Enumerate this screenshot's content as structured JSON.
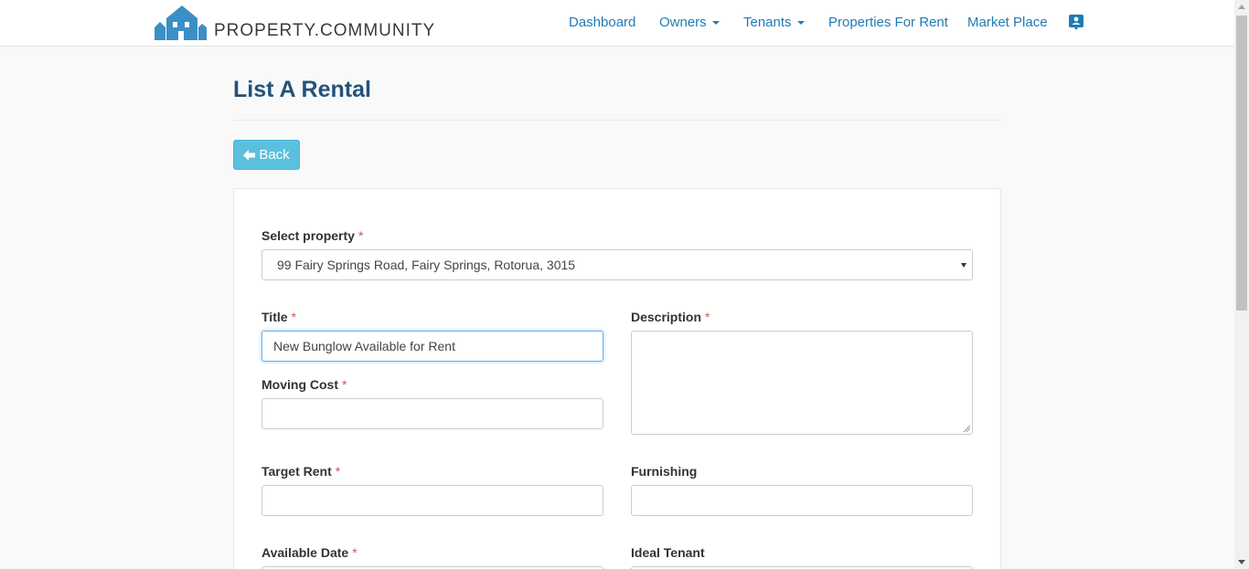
{
  "brand": {
    "name": "PROPERTY.COMMUNITY",
    "color": "#3b8fc6"
  },
  "nav": {
    "items": [
      {
        "label": "Dashboard",
        "has_dropdown": false
      },
      {
        "label": "Owners",
        "has_dropdown": true
      },
      {
        "label": "Tenants",
        "has_dropdown": true
      },
      {
        "label": "Properties For Rent",
        "has_dropdown": false
      },
      {
        "label": "Market Place",
        "has_dropdown": false
      }
    ],
    "profile_icon": "contact-card-icon",
    "link_color": "#1f7bb6"
  },
  "page": {
    "title": "List A Rental",
    "back_label": "Back",
    "back_icon": "arrow-left-icon"
  },
  "form": {
    "required_mark": "*",
    "property": {
      "label": "Select property",
      "value": "99 Fairy Springs Road, Fairy Springs, Rotorua, 3015",
      "required": true
    },
    "title": {
      "label": "Title",
      "value": "New Bunglow Available for Rent",
      "required": true
    },
    "description": {
      "label": "Description",
      "value": "",
      "required": true
    },
    "moving_cost": {
      "label": "Moving Cost",
      "value": "",
      "required": true
    },
    "target_rent": {
      "label": "Target Rent",
      "value": "",
      "required": true
    },
    "furnishing": {
      "label": "Furnishing",
      "value": "",
      "required": false
    },
    "available_date": {
      "label": "Available Date",
      "value": "",
      "required": true
    },
    "ideal_tenant": {
      "label": "Ideal Tenant",
      "value": "",
      "required": false
    }
  }
}
